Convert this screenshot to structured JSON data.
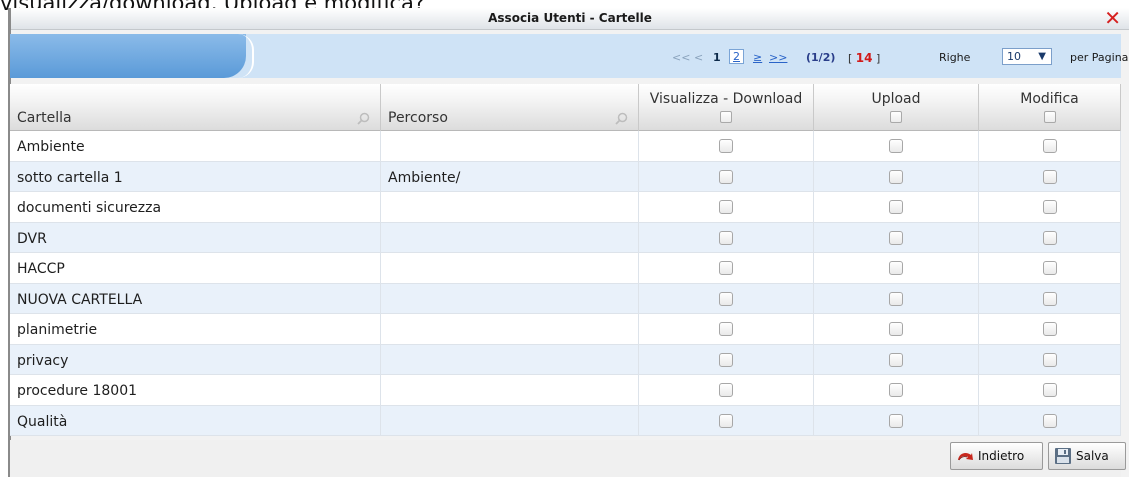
{
  "background_caption": "visualizza/download, Upload e modifica?",
  "dialog": {
    "title": "Associa Utenti - Cartelle",
    "close_symbol": "✕"
  },
  "pager": {
    "first": "<<",
    "prev": "<",
    "current_page": "1",
    "page_two": "2",
    "next": "≥",
    "last": ">>",
    "page_info": "(1/2)",
    "count_open": "[",
    "total_count": "14",
    "count_close": "]",
    "rows_label": "Righe",
    "per_page_value": "10",
    "per_page_label": "per Pagina"
  },
  "table": {
    "columns": {
      "folder": "Cartella",
      "path": "Percorso",
      "view_download": "Visualizza - Download",
      "upload": "Upload",
      "edit": "Modifica"
    },
    "rows": [
      {
        "folder": "Ambiente",
        "path": ""
      },
      {
        "folder": "sotto cartella 1",
        "path": "Ambiente/"
      },
      {
        "folder": "documenti sicurezza",
        "path": ""
      },
      {
        "folder": "DVR",
        "path": ""
      },
      {
        "folder": "HACCP",
        "path": ""
      },
      {
        "folder": "NUOVA CARTELLA",
        "path": ""
      },
      {
        "folder": "planimetrie",
        "path": ""
      },
      {
        "folder": "privacy",
        "path": ""
      },
      {
        "folder": "procedure 18001",
        "path": ""
      },
      {
        "folder": "Qualità",
        "path": ""
      }
    ]
  },
  "buttons": {
    "back": "Indietro",
    "save": "Salva"
  },
  "icons": {
    "close": "close-icon",
    "search": "magnifier-icon",
    "back": "back-arrow-icon",
    "save": "floppy-disk-icon"
  },
  "colors": {
    "header_band": "#cfe3f6",
    "active_tab": "#5a9ad8",
    "even_row": "#e9f1fa",
    "close_red": "#d62020",
    "count_red": "#d21b1b"
  }
}
